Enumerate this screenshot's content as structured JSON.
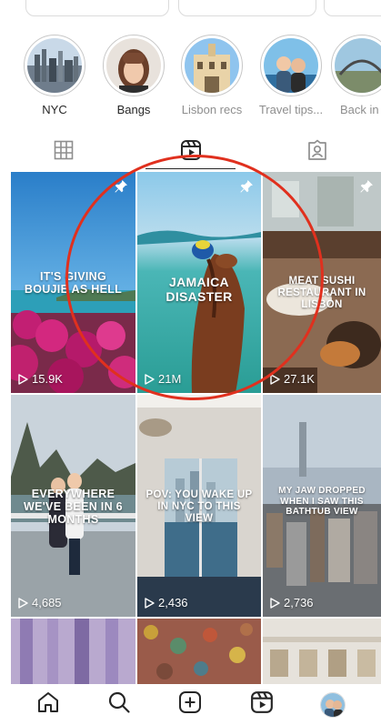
{
  "highlights": [
    {
      "label": "NYC",
      "muted": false
    },
    {
      "label": "Bangs",
      "muted": false
    },
    {
      "label": "Lisbon recs",
      "muted": true
    },
    {
      "label": "Travel tips...",
      "muted": true
    },
    {
      "label": "Back in",
      "muted": true
    }
  ],
  "tabs": [
    {
      "icon": "grid-icon"
    },
    {
      "icon": "reels-icon"
    },
    {
      "icon": "tagged-icon"
    }
  ],
  "posts": [
    {
      "caption": "IT'S GIVING BOUJIE AS HELL",
      "views": "15.9K",
      "pinned": true
    },
    {
      "caption": "JAMAICA DISASTER",
      "views": "21M",
      "pinned": true
    },
    {
      "caption": "MEAT SUSHI RESTAURANT IN LISBON",
      "views": "27.1K",
      "pinned": true
    },
    {
      "caption": "EVERYWHERE WE'VE BEEN IN 6 MONTHS",
      "views": "4,685",
      "pinned": false
    },
    {
      "caption": "POV: YOU WAKE UP IN NYC TO THIS VIEW",
      "views": "2,436",
      "pinned": false
    },
    {
      "caption": "MY JAW DROPPED WHEN I SAW THIS BATHTUB VIEW",
      "views": "2,736",
      "pinned": false
    }
  ],
  "bottom_nav": [
    {
      "icon": "home-icon"
    },
    {
      "icon": "search-icon"
    },
    {
      "icon": "create-icon"
    },
    {
      "icon": "reels-icon"
    },
    {
      "icon": "profile-avatar"
    }
  ],
  "colors": {
    "annotation_circle": "#e0301e",
    "icon": "#262626",
    "muted_text": "#8e8e8e"
  }
}
